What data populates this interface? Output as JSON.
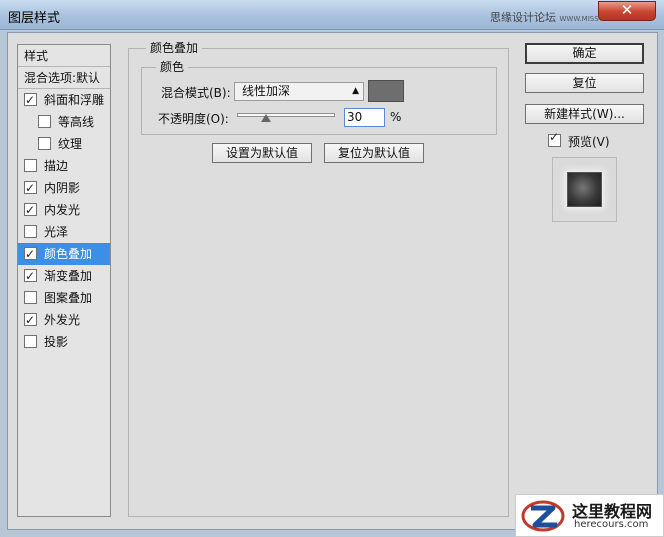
{
  "window": {
    "title": "图层样式",
    "site_mark": "思缘设计论坛",
    "site_mark_small": "WWW.MISSYUAN.COM",
    "close_glyph": "✕"
  },
  "styles_list": {
    "header": "样式",
    "blending": "混合选项:默认",
    "items": [
      {
        "label": "斜面和浮雕",
        "checked": true
      },
      {
        "label": "等高线",
        "checked": false
      },
      {
        "label": "纹理",
        "checked": false
      },
      {
        "label": "描边",
        "checked": false
      },
      {
        "label": "内阴影",
        "checked": true
      },
      {
        "label": "内发光",
        "checked": true
      },
      {
        "label": "光泽",
        "checked": false
      },
      {
        "label": "颜色叠加",
        "checked": true,
        "selected": true
      },
      {
        "label": "渐变叠加",
        "checked": true
      },
      {
        "label": "图案叠加",
        "checked": false
      },
      {
        "label": "外发光",
        "checked": true
      },
      {
        "label": "投影",
        "checked": false
      }
    ]
  },
  "panel": {
    "title": "颜色叠加",
    "group_title": "颜色",
    "blend_mode_label": "混合模式(B):",
    "blend_mode_value": "线性加深",
    "overlay_color": "#6e6e6e",
    "opacity_label": "不透明度(O):",
    "opacity_value": "30",
    "opacity_unit": "%",
    "opacity_slider_fraction": 0.3,
    "set_default_label": "设置为默认值",
    "reset_default_label": "复位为默认值"
  },
  "actions": {
    "ok": "确定",
    "reset": "复位",
    "new_style": "新建样式(W)...",
    "preview_label": "预览(V)",
    "preview_checked": true
  },
  "watermark": {
    "name": "这里教程网",
    "url": "herecours.com"
  }
}
